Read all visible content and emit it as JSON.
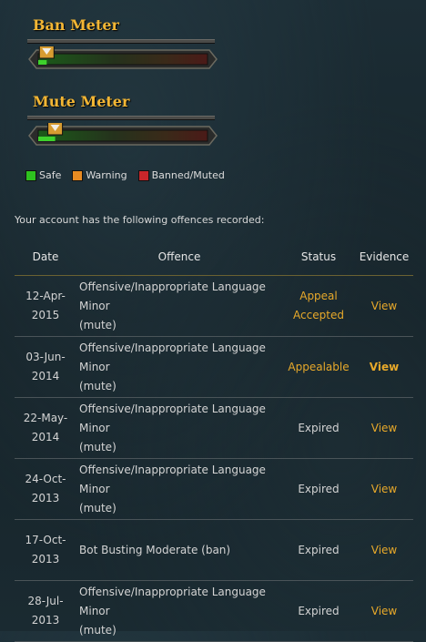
{
  "ban_meter": {
    "title": "Ban Meter",
    "level": 0.05
  },
  "mute_meter": {
    "title": "Mute Meter",
    "level": 0.1
  },
  "legend": [
    {
      "label": "Safe",
      "color": "#2ec11f"
    },
    {
      "label": "Warning",
      "color": "#e88b22"
    },
    {
      "label": "Banned/Muted",
      "color": "#c8262a"
    }
  ],
  "intro": "Your account has the following offences recorded:",
  "table": {
    "headers": {
      "date": "Date",
      "offence": "Offence",
      "status": "Status",
      "evidence": "Evidence"
    },
    "rows": [
      {
        "date1": "12-Apr-",
        "date2": "2015",
        "offence1": "Offensive/Inappropriate Language Minor",
        "offence2": "(mute)",
        "status1": "Appeal",
        "status2": "Accepted",
        "evidence": "View"
      },
      {
        "date1": "03-Jun-",
        "date2": "2014",
        "offence1": "Offensive/Inappropriate Language Minor",
        "offence2": "(mute)",
        "status1": "Appealable",
        "status2": "",
        "evidence": "View"
      },
      {
        "date1": "22-May-",
        "date2": "2014",
        "offence1": "Offensive/Inappropriate Language Minor",
        "offence2": "(mute)",
        "status1": "Expired",
        "status2": "",
        "evidence": "View"
      },
      {
        "date1": "24-Oct-",
        "date2": "2013",
        "offence1": "Offensive/Inappropriate Language Minor",
        "offence2": "(mute)",
        "status1": "Expired",
        "status2": "",
        "evidence": "View"
      },
      {
        "date1": "17-Oct-",
        "date2": "2013",
        "offence1": "Bot Busting Moderate (ban)",
        "offence2": "",
        "status1": "Expired",
        "status2": "",
        "evidence": "View"
      },
      {
        "date1": "28-Jul-",
        "date2": "2013",
        "offence1": "Offensive/Inappropriate Language Minor",
        "offence2": "(mute)",
        "status1": "Expired",
        "status2": "",
        "evidence": "View"
      }
    ]
  }
}
